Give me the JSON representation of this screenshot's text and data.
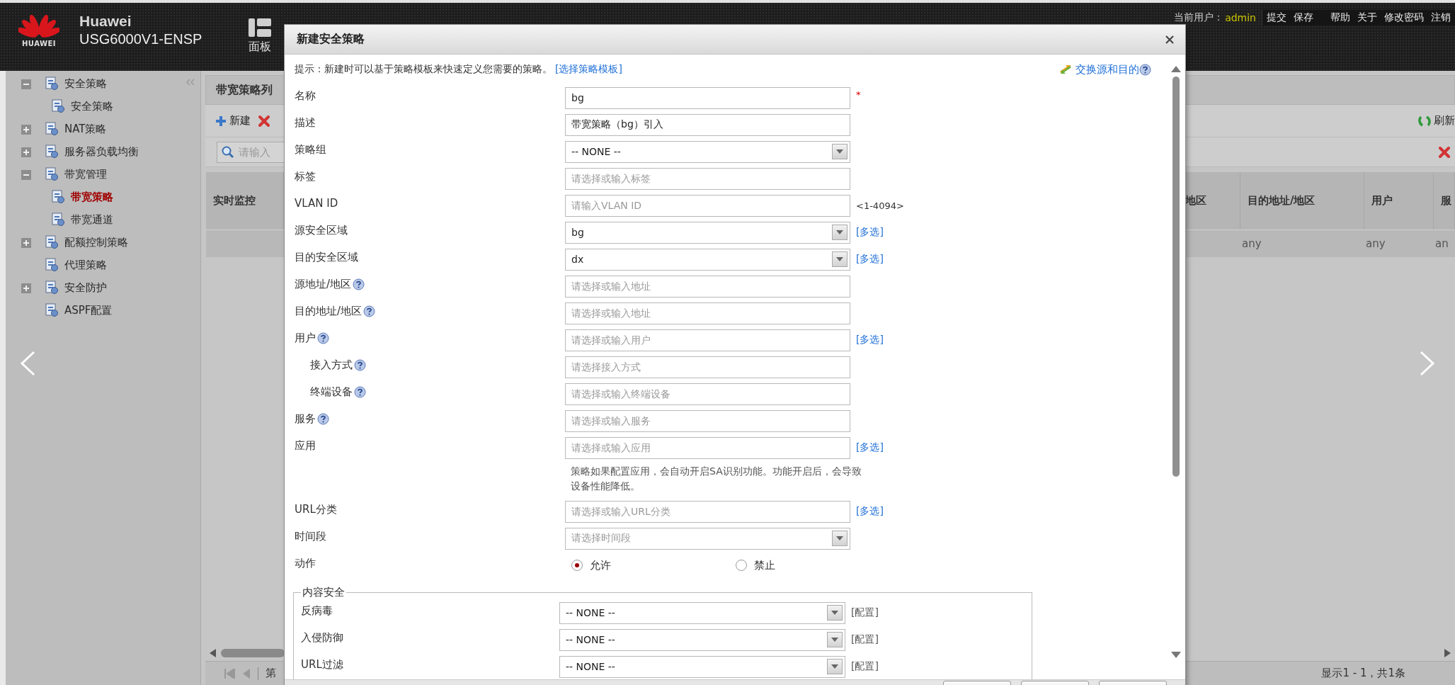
{
  "header": {
    "logo_text": "HUAWEI",
    "brand": "Huawei",
    "device": "USG6000V1-ENSP",
    "nav_label": "面板",
    "user_label": "当前用户：",
    "user": "admin",
    "actions": [
      "提交",
      "保存"
    ],
    "links": [
      "帮助",
      "关于",
      "修改密码",
      "注销"
    ]
  },
  "sidebar": {
    "items": [
      {
        "label": "安全策略",
        "expanded": true,
        "selected": false,
        "children": [
          {
            "label": "安全策略",
            "selected": false
          }
        ]
      },
      {
        "label": "NAT策略",
        "expanded": false,
        "selected": false
      },
      {
        "label": "服务器负载均衡",
        "expanded": false,
        "selected": false
      },
      {
        "label": "带宽管理",
        "expanded": true,
        "selected": false,
        "children": [
          {
            "label": "带宽策略",
            "selected": true
          },
          {
            "label": "带宽通道",
            "selected": false
          }
        ]
      },
      {
        "label": "配额控制策略",
        "expanded": false,
        "selected": false
      },
      {
        "label": "代理策略",
        "selected": false
      },
      {
        "label": "安全防护",
        "expanded": false,
        "selected": false
      },
      {
        "label": "ASPF配置",
        "selected": false
      }
    ]
  },
  "panel": {
    "title": "带宽策略列",
    "new_label": "新建",
    "refresh_label": "刷新",
    "search": {
      "placeholder": "请输入"
    },
    "columns_left": [
      "实时监控"
    ],
    "columns_right": [
      "地区",
      "目的地址/地区",
      "用户",
      "服"
    ],
    "rows": [
      {
        "destination": "any",
        "user": "any",
        "service": "an"
      }
    ],
    "pager": {
      "page_label": "第",
      "summary": "显示1 - 1，共1条"
    }
  },
  "dialog": {
    "title": "新建安全策略",
    "hint": "提示：新建时可以基于策略模板来快速定义您需要的策略。",
    "template_link": "[选择策略模板]",
    "swap_link": "交换源和目的",
    "fields": [
      {
        "label": "名称",
        "kind": "text",
        "value": "bg",
        "help": false,
        "required_mark": "*"
      },
      {
        "label": "描述",
        "kind": "text",
        "value": "带宽策略（bg）引入",
        "help": false
      },
      {
        "label": "策略组",
        "kind": "select",
        "value": "-- NONE --",
        "help": false
      },
      {
        "label": "标签",
        "kind": "text",
        "placeholder": "请选择或输入标签",
        "help": false
      },
      {
        "label": "VLAN ID",
        "kind": "text",
        "placeholder": "请输入VLAN ID",
        "help": false,
        "suffix": "<1-4094>"
      },
      {
        "label": "源安全区域",
        "kind": "select",
        "value": "bg",
        "help": false,
        "link": "[多选]"
      },
      {
        "label": "目的安全区域",
        "kind": "select",
        "value": "dx",
        "help": false,
        "link": "[多选]"
      },
      {
        "label": "源地址/地区",
        "kind": "text",
        "placeholder": "请选择或输入地址",
        "help": true
      },
      {
        "label": "目的地址/地区",
        "kind": "text",
        "placeholder": "请选择或输入地址",
        "help": true
      },
      {
        "label": "用户",
        "kind": "text",
        "placeholder": "请选择或输入用户",
        "help": true,
        "link": "[多选]",
        "children": [
          {
            "label": "接入方式",
            "kind": "text",
            "placeholder": "请选择接入方式",
            "help": true
          },
          {
            "label": "终端设备",
            "kind": "text",
            "placeholder": "请选择或输入终端设备",
            "help": true
          }
        ]
      },
      {
        "label": "服务",
        "kind": "text",
        "placeholder": "请选择或输入服务",
        "help": true
      },
      {
        "label": "应用",
        "kind": "text",
        "placeholder": "请选择或输入应用",
        "help": false,
        "link": "[多选]",
        "note": "策略如果配置应用，会自动开启SA识别功能。功能开启后，会导致设备性能降低。"
      },
      {
        "label": "URL分类",
        "kind": "text",
        "placeholder": "请选择或输入URL分类",
        "help": false,
        "link": "[多选]"
      },
      {
        "label": "时间段",
        "kind": "select",
        "placeholder": "请选择时间段",
        "help": false
      }
    ],
    "action": {
      "label": "动作",
      "options": [
        {
          "label": "允许",
          "selected": true
        },
        {
          "label": "禁止",
          "selected": false
        }
      ]
    },
    "content_security": {
      "legend": "内容安全",
      "rows": [
        {
          "label": "反病毒",
          "value": "-- NONE --",
          "link": "[配置]"
        },
        {
          "label": "入侵防御",
          "value": "-- NONE --",
          "link": "[配置]"
        },
        {
          "label": "URL过滤",
          "value": "-- NONE --",
          "link": "[配置]"
        }
      ]
    }
  }
}
